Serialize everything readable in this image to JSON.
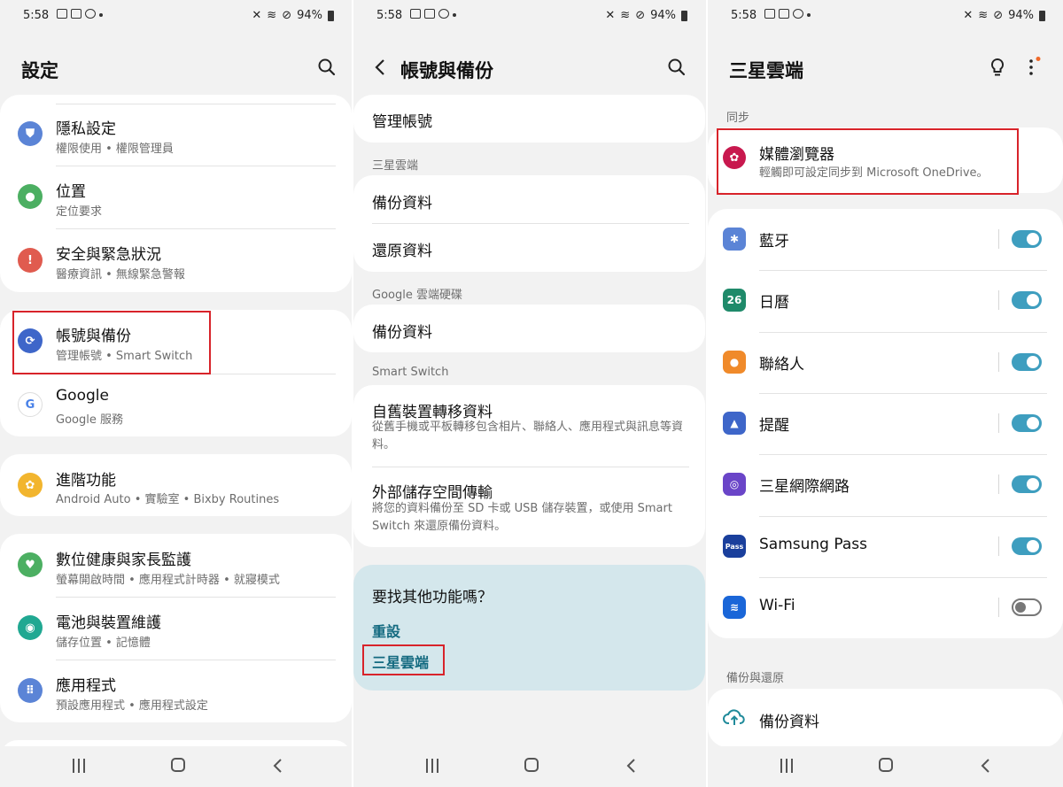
{
  "status": {
    "time": "5:58",
    "battery": "94%"
  },
  "settings": {
    "title": "設定",
    "items": [
      {
        "title": "隱私設定",
        "subtitle": "權限使用 • 權限管理員",
        "icon": "shield-icon",
        "color": "#5b84d6"
      },
      {
        "title": "位置",
        "subtitle": "定位要求",
        "icon": "location-pin-icon",
        "color": "#4caf62"
      },
      {
        "title": "安全與緊急狀況",
        "subtitle": "醫療資訊 • 無線緊急警報",
        "icon": "alert-icon",
        "color": "#e05b4f"
      },
      {
        "title": "帳號與備份",
        "subtitle": "管理帳號 • Smart Switch",
        "icon": "sync-icon",
        "color": "#3e66c9"
      },
      {
        "title": "Google",
        "subtitle": "Google 服務",
        "icon": "google-icon",
        "color": "#4a82e8"
      },
      {
        "title": "進階功能",
        "subtitle": "Android Auto • 實驗室 • Bixby Routines",
        "icon": "puzzle-icon",
        "color": "#f2b52e"
      },
      {
        "title": "數位健康與家長監護",
        "subtitle": "螢幕開啟時間 • 應用程式計時器 • 就寢模式",
        "icon": "heart-icon",
        "color": "#4caf62"
      },
      {
        "title": "電池與裝置維護",
        "subtitle": "儲存位置 • 記憶體",
        "icon": "battery-care-icon",
        "color": "#20a892"
      },
      {
        "title": "應用程式",
        "subtitle": "預設應用程式 • 應用程式設定",
        "icon": "apps-grid-icon",
        "color": "#5b84d6"
      }
    ]
  },
  "accounts": {
    "title": "帳號與備份",
    "manage": "管理帳號",
    "section_cloud": "三星雲端",
    "cloud_backup": "備份資料",
    "cloud_restore": "還原資料",
    "section_gdrive": "Google 雲端硬碟",
    "gdrive_backup": "備份資料",
    "section_smartswitch": "Smart Switch",
    "transfer_title": "自舊裝置轉移資料",
    "transfer_sub": "從舊手機或平板轉移包含相片、聯絡人、應用程式與訊息等資料。",
    "external_title": "外部儲存空間傳輸",
    "external_sub": "將您的資料備份至 SD 卡或 USB 儲存裝置，或使用 Smart Switch 來還原備份資料。",
    "tip_question": "要找其他功能嗎？",
    "tip_link1": "重設",
    "tip_link2": "三星雲端"
  },
  "cloud": {
    "title": "三星雲端",
    "section_sync": "同步",
    "gallery_title": "媒體瀏覽器",
    "gallery_sub": "輕觸即可設定同步到 Microsoft OneDrive。",
    "toggles": [
      {
        "label": "藍牙",
        "on": true,
        "icon": "bluetooth-icon",
        "color": "#5b84d6",
        "glyph": "✱"
      },
      {
        "label": "日曆",
        "on": true,
        "icon": "calendar-icon",
        "color": "#1f8a6a",
        "glyph": "26"
      },
      {
        "label": "聯絡人",
        "on": true,
        "icon": "contact-icon",
        "color": "#f08a2a",
        "glyph": "●"
      },
      {
        "label": "提醒",
        "on": true,
        "icon": "bell-icon",
        "color": "#3e66c9",
        "glyph": "▲"
      },
      {
        "label": "三星網際網路",
        "on": true,
        "icon": "internet-icon",
        "color": "#6a45c8",
        "glyph": "◎"
      },
      {
        "label": "Samsung Pass",
        "on": true,
        "icon": "samsung-pass-icon",
        "color": "#1a3f9c",
        "glyph": "Pass"
      },
      {
        "label": "Wi-Fi",
        "on": false,
        "icon": "wifi-icon",
        "color": "#1a66d8",
        "glyph": "≋"
      }
    ],
    "section_backup": "備份與還原",
    "backup": "備份資料"
  }
}
